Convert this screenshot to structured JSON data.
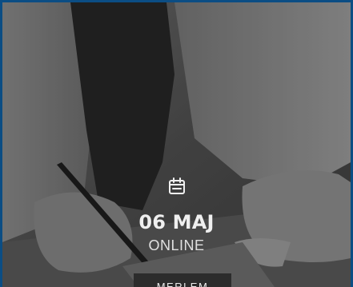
{
  "event": {
    "date": "06 MAJ",
    "location": "ONLINE",
    "more_label": "MERLEM"
  },
  "icons": {
    "date": "calendar-icon"
  },
  "colors": {
    "frame": "#0b4d84",
    "text": "#efefef",
    "button_bg": "#2c2c2c"
  }
}
